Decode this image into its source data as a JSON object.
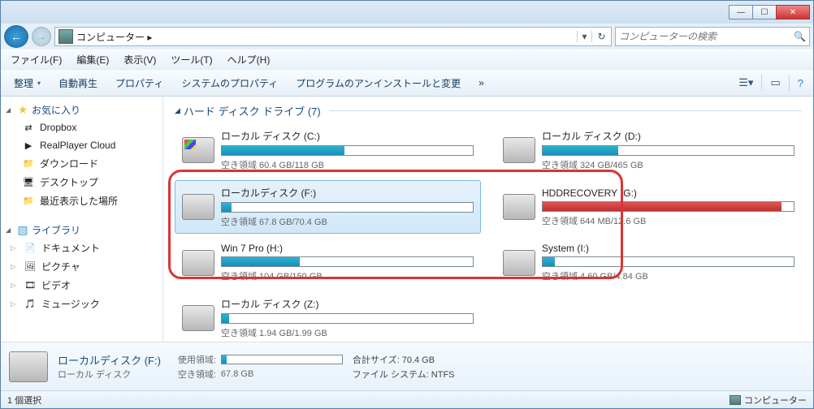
{
  "window": {
    "minimize": "—",
    "maximize": "☐",
    "close": "✕"
  },
  "nav": {
    "back": "←",
    "fwd": "→",
    "location_icon": "🖥",
    "breadcrumb": "コンピューター ▸",
    "dropdown": "▾",
    "refresh": "↻"
  },
  "search": {
    "placeholder": "コンピューターの検索",
    "icon": "🔍"
  },
  "menu": {
    "file": "ファイル(F)",
    "edit": "編集(E)",
    "view": "表示(V)",
    "tools": "ツール(T)",
    "help": "ヘルプ(H)"
  },
  "toolbar": {
    "organize": "整理",
    "autoplay": "自動再生",
    "properties": "プロパティ",
    "system_properties": "システムのプロパティ",
    "uninstall": "プログラムのアンインストールと変更",
    "more": "»",
    "view_icon": "☰▾",
    "pane_icon": "▭",
    "help_icon": "?"
  },
  "sidebar": {
    "favorites": {
      "label": "お気に入り",
      "items": [
        {
          "icon": "⇄",
          "label": "Dropbox"
        },
        {
          "icon": "▶",
          "label": "RealPlayer Cloud"
        },
        {
          "icon": "📁",
          "label": "ダウンロード"
        },
        {
          "icon": "🖥",
          "label": "デスクトップ"
        },
        {
          "icon": "📁",
          "label": "最近表示した場所"
        }
      ]
    },
    "libraries": {
      "label": "ライブラリ",
      "items": [
        {
          "icon": "📄",
          "label": "ドキュメント"
        },
        {
          "icon": "🖼",
          "label": "ピクチャ"
        },
        {
          "icon": "🎞",
          "label": "ビデオ"
        },
        {
          "icon": "🎵",
          "label": "ミュージック"
        }
      ]
    }
  },
  "section_title": "ハード ディスク ドライブ (7)",
  "drives": [
    {
      "label": "ローカル ディスク (C:)",
      "free": "空き領域 60.4 GB/118 GB",
      "fill": 49,
      "color": "teal",
      "selected": false,
      "os": true
    },
    {
      "label": "ローカル ディスク (D:)",
      "free": "空き領域 324 GB/465 GB",
      "fill": 30,
      "color": "teal",
      "selected": false,
      "os": false
    },
    {
      "label": "ローカルディスク (F:)",
      "free": "空き領域 67.8 GB/70.4 GB",
      "fill": 4,
      "color": "teal",
      "selected": true,
      "os": false
    },
    {
      "label": "HDDRECOVERY (G:)",
      "free": "空き領域 644 MB/12.6 GB",
      "fill": 95,
      "color": "red",
      "selected": false,
      "os": false
    },
    {
      "label": "Win 7 Pro (H:)",
      "free": "空き領域 104 GB/150 GB",
      "fill": 31,
      "color": "teal",
      "selected": false,
      "os": false
    },
    {
      "label": "System (I:)",
      "free": "空き領域 4.60 GB/4.84 GB",
      "fill": 5,
      "color": "teal",
      "selected": false,
      "os": false
    },
    {
      "label": "ローカル ディスク (Z:)",
      "free": "空き領域 1.94 GB/1.99 GB",
      "fill": 3,
      "color": "teal",
      "selected": false,
      "os": false
    }
  ],
  "details": {
    "title": "ローカルディスク (F:)",
    "subtitle": "ローカル ディスク",
    "used_label": "使用領域:",
    "free_label": "空き領域:",
    "free_value": "67.8 GB",
    "used_fill": 4,
    "total_label": "合計サイズ:",
    "total_value": "70.4 GB",
    "fs_label": "ファイル システム:",
    "fs_value": "NTFS"
  },
  "status": {
    "selection": "1 個選択",
    "computer": "コンピューター"
  }
}
